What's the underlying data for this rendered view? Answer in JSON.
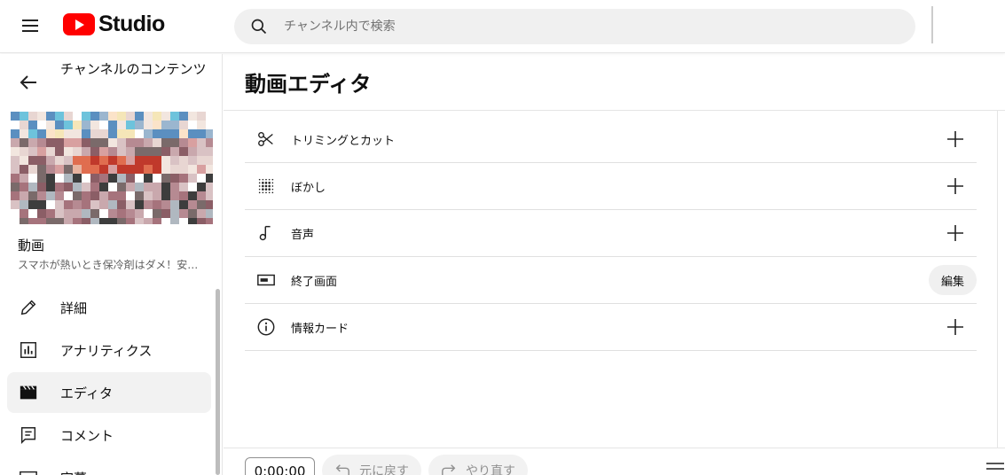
{
  "header": {
    "logo_text": "Studio",
    "search_placeholder": "チャンネル内で検索"
  },
  "sidebar": {
    "channel_title": "チャンネルのコンテンツ",
    "video_label": "動画",
    "video_name": "スマホが熱いとき保冷剤はダメ！安全に冷やす方法",
    "nav": [
      {
        "label": "詳細",
        "icon": "pencil-icon"
      },
      {
        "label": "アナリティクス",
        "icon": "analytics-icon"
      },
      {
        "label": "エディタ",
        "icon": "clapper-icon",
        "active": true
      },
      {
        "label": "コメント",
        "icon": "comment-icon"
      },
      {
        "label": "字幕",
        "icon": "subtitles-icon"
      }
    ]
  },
  "main": {
    "title": "動画エディタ",
    "rows": [
      {
        "label": "トリミングとカット",
        "icon": "scissors-icon",
        "action": "plus"
      },
      {
        "label": "ぼかし",
        "icon": "blur-icon",
        "action": "plus"
      },
      {
        "label": "音声",
        "icon": "music-note-icon",
        "action": "plus"
      },
      {
        "label": "終了画面",
        "icon": "end-screen-icon",
        "action": "edit",
        "action_label": "編集"
      },
      {
        "label": "情報カード",
        "icon": "info-icon",
        "action": "plus"
      }
    ]
  },
  "toolbar": {
    "time": "0:00:00",
    "undo_label": "元に戻す",
    "redo_label": "やり直す"
  },
  "colors": {
    "brand_red": "#ff0000",
    "active_bg": "#f2f2f2",
    "search_bg": "#f0f0f0"
  }
}
